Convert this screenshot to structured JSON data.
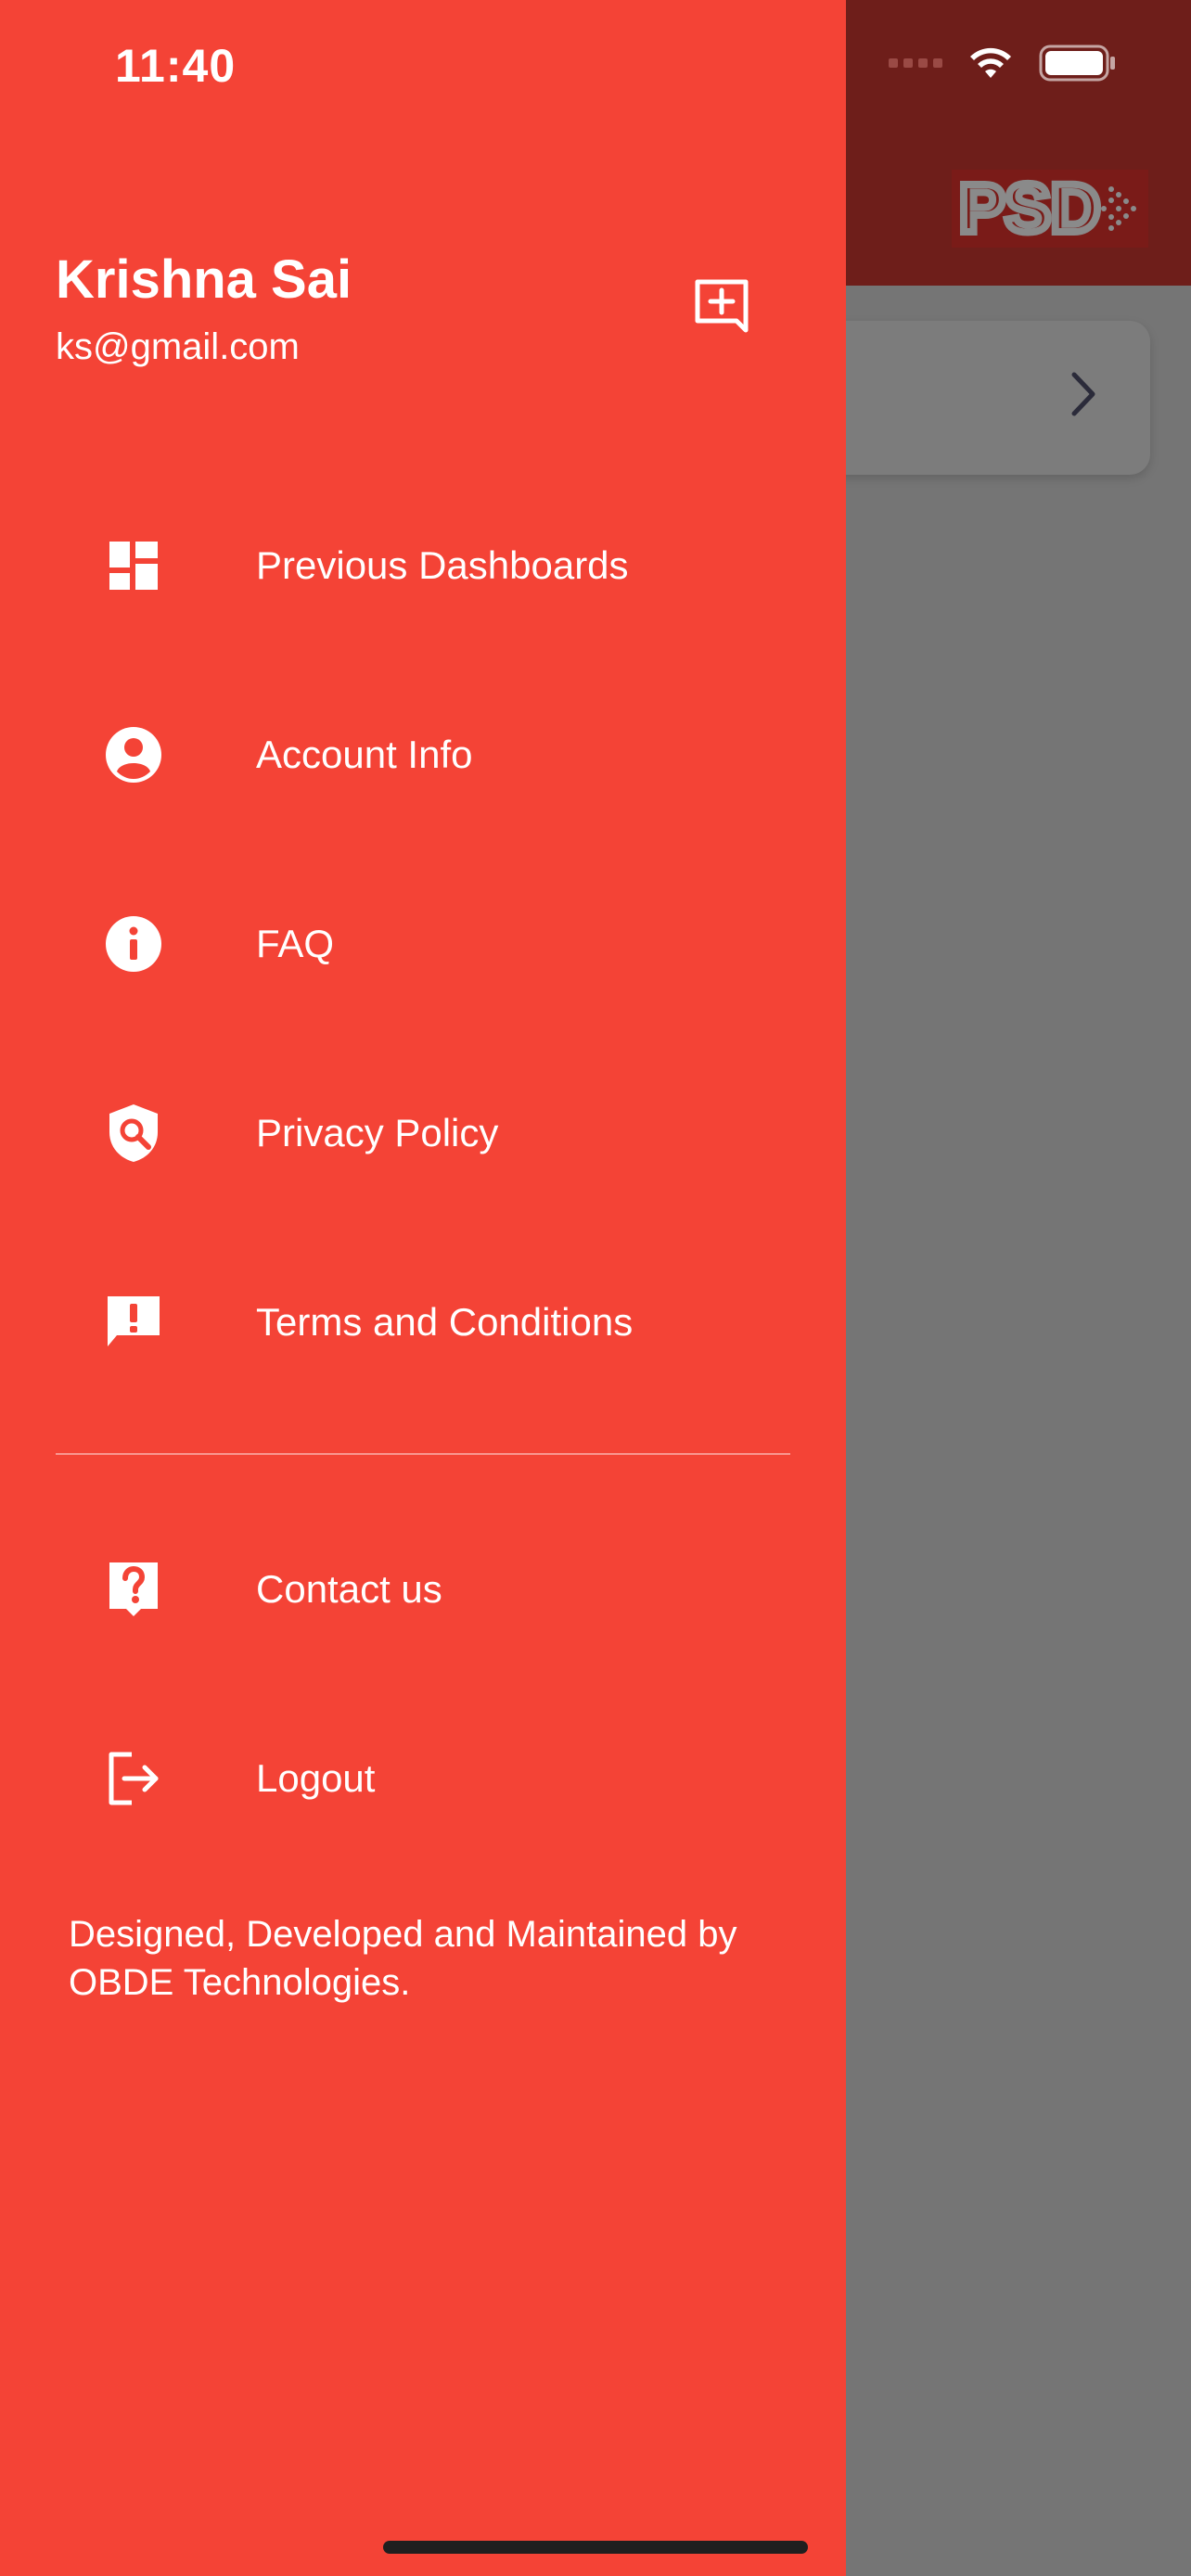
{
  "status_bar": {
    "time": "11:40"
  },
  "profile": {
    "name": "Krishna Sai",
    "email": "ks@gmail.com"
  },
  "menu": {
    "items": [
      {
        "label": "Previous Dashboards",
        "icon": "dashboard-icon"
      },
      {
        "label": "Account Info",
        "icon": "account-circle-icon"
      },
      {
        "label": "FAQ",
        "icon": "info-icon"
      },
      {
        "label": "Privacy Policy",
        "icon": "privacy-shield-icon"
      },
      {
        "label": "Terms and Conditions",
        "icon": "feedback-icon"
      }
    ],
    "secondary_items": [
      {
        "label": "Contact us",
        "icon": "help-icon"
      },
      {
        "label": "Logout",
        "icon": "logout-icon"
      }
    ]
  },
  "footer": {
    "credit_line1": "Designed, Developed and Maintained by",
    "credit_line2": "OBDE Technologies."
  },
  "background_app": {
    "logo_text": "PSD"
  },
  "colors": {
    "drawer": "#f44336",
    "app_bar_dimmed": "#6e1e1a",
    "scrim": "#757575"
  }
}
